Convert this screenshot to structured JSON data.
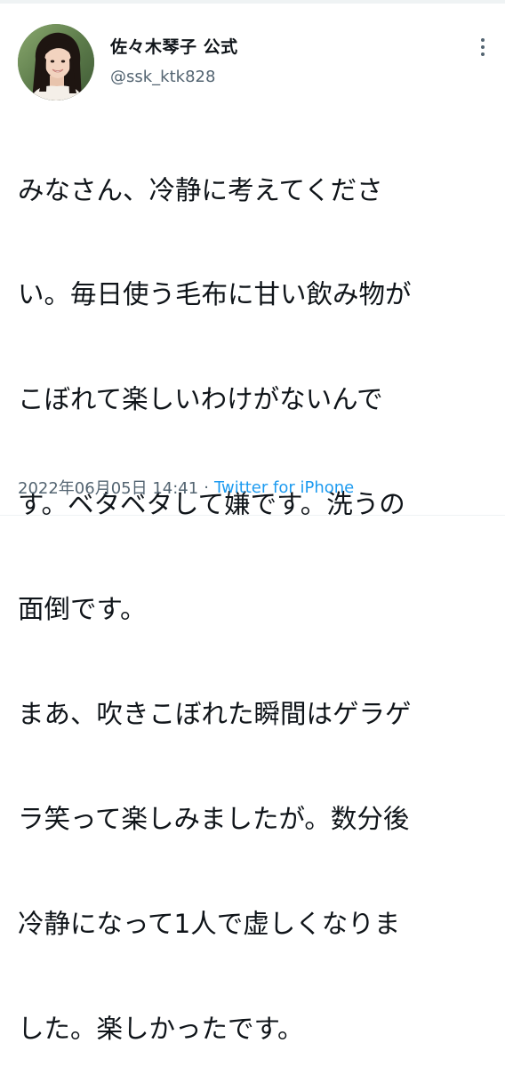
{
  "tweet": {
    "display_name": "佐々木琴子 公式",
    "handle": "@ssk_ktk828",
    "text_lines": [
      "みなさん、冷静に考えてくださ",
      "い。毎日使う毛布に甘い飲み物が",
      "こぼれて楽しいわけがないんで",
      "す。ベタベタして嫌です。洗うの",
      "面倒です。",
      "まあ、吹きこぼれた瞬間はゲラゲ",
      "ラ笑って楽しみましたが。数分後",
      "冷静になって1人で虚しくなりま",
      "した。楽しかったです。"
    ],
    "timestamp": "2022年06月05日 14:41",
    "separator": "·",
    "source": "Twitter for iPhone"
  },
  "icons": {
    "avatar": "profile-photo",
    "more": "more-vertical-icon"
  },
  "colors": {
    "text": "#0f1419",
    "secondary": "#536471",
    "link": "#1d9bf0",
    "divider": "#eff3f4"
  }
}
